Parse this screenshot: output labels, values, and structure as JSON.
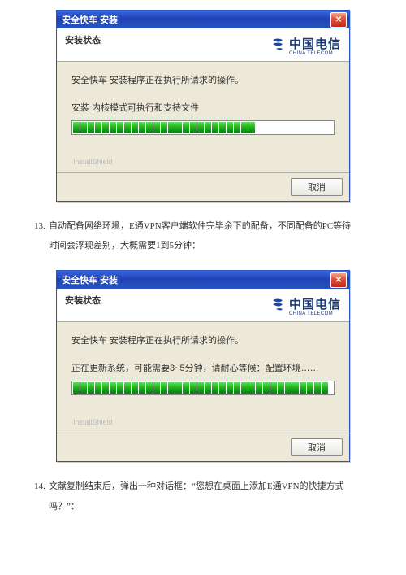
{
  "dialog1": {
    "title": "安全快车 安装",
    "subtitle": "安装状态",
    "brand_cn": "中国电信",
    "brand_en": "CHINA TELECOM",
    "status": "安全快车 安装程序正在执行所请求的操作。",
    "task": "安装 内核模式可执行和支持文件",
    "watermark": "InstallShield",
    "cancel": "取消",
    "progress_filled": 25,
    "progress_total": 35
  },
  "step13": {
    "num": "13.",
    "text": "自动配备网络环境，E通VPN客户端软件完毕余下的配备，不同配备的PC等待时间会浮现差别，大概需要1到5分钟："
  },
  "dialog2": {
    "title": "安全快车 安装",
    "subtitle": "安装状态",
    "brand_cn": "中国电信",
    "brand_en": "CHINA TELECOM",
    "status": "安全快车 安装程序正在执行所请求的操作。",
    "task": "正在更新系统，可能需要3~5分钟，请耐心等候：配置环境……",
    "watermark": "InstallShield",
    "cancel": "取消",
    "progress_filled": 35,
    "progress_total": 35
  },
  "step14": {
    "num": "14.",
    "text": "文献复制结束后，弹出一种对话框：“您想在桌面上添加E通VPN的快捷方式吗？”："
  }
}
